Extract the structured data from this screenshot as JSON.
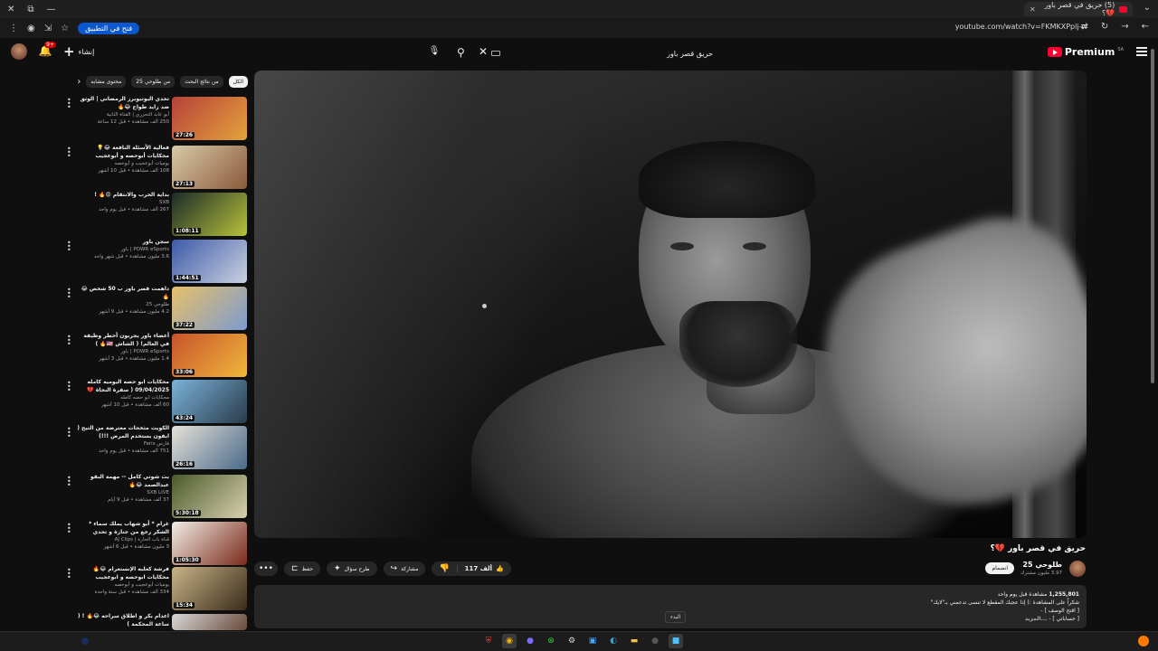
{
  "browser": {
    "tab_title": "(5) حريق في قصر باور 💔؟",
    "url": "youtube.com/watch?v=FKMKXPplj-w",
    "open_in_app": "فتح في التطبيق"
  },
  "masthead": {
    "create_label": "إنشاء",
    "notifications_badge": "9+",
    "search_value": "حريق قصر باور",
    "logo_text": "Premium",
    "logo_region": "SA"
  },
  "chips": [
    "الكل",
    "من نتائج البحث",
    "من طلوحي 25",
    "محتوى مشابه"
  ],
  "related": [
    {
      "title": "تحدي اليوتيوبرز الرمضاني | الوثق ضد زايد طواح 😂🔥",
      "channel": "أبو عابد التحرري | القناة الثانية",
      "meta": "250 ألف مشاهدة • قبل 12 ساعة",
      "duration": "27:26",
      "c1": "#b6413a",
      "c2": "#e4a23b"
    },
    {
      "title": "فعالية الأسئلة النافعة 😂💡 محكايات أبوحصه و أبوعجيب",
      "channel": "يوميات أبوعجيب و أبوحصه",
      "meta": "108 ألف مشاهدة • قبل 10 أشهر",
      "duration": "27:13",
      "c1": "#d8c9a8",
      "c2": "#8a5a3a"
    },
    {
      "title": "بداية الحرب والانتقام 😡🔥 !",
      "channel": "SXB",
      "meta": "267 ألف مشاهدة • قبل يوم واحد",
      "duration": "1:08:11",
      "c1": "#1b2a28",
      "c2": "#b7c23a"
    },
    {
      "title": "سجن باور",
      "channel": "POWR eSports | باور",
      "meta": "3.6 مليون مشاهدة • قبل شهر واحد",
      "duration": "1:44:51",
      "c1": "#3d5aa8",
      "c2": "#c9d1e0"
    },
    {
      "title": "داهمت قصر باور ب 50 شخص 😂🔥",
      "channel": "طلوحي 25",
      "meta": "4.2 مليون مشاهدة • قبل 9 أشهر",
      "duration": "37:22",
      "c1": "#e6c06a",
      "c2": "#7e9bcf"
    },
    {
      "title": "أعضاء باور يجربون أخطر وظيفة في العالم! ( الشاش 🇺🇸🔥 )",
      "channel": "POWR eSports | باور",
      "meta": "1.4 مليون مشاهدة • قبل 3 أشهر",
      "duration": "33:06",
      "c1": "#c8532c",
      "c2": "#f0b73a"
    },
    {
      "title": "محكايات ابو حصه اليوميه كامله 09/04/2025 ( سفرة النجاة 💔",
      "channel": "محكايات ابو حصه كامله",
      "meta": "60 ألف مشاهدة • قبل 10 أشهر",
      "duration": "43:24",
      "c1": "#7ab3d9",
      "c2": "#2a3a4a"
    },
    {
      "title": "الكويت مثخحات معترضة من التيح ( ايفون يستخدم المرض !!!)",
      "channel": "فارس Faris",
      "meta": "751 ألف مشاهدة • قبل يوم واحد",
      "duration": "26:16",
      "c1": "#e6e2d8",
      "c2": "#4a6a8a"
    },
    {
      "title": "بث شوتي كامل -- مهمة البقو عبدالصمد 😂🔥",
      "channel": "SXB LIVE",
      "meta": "37 ألف مشاهدة • قبل 9 أيام",
      "duration": "5:30:18",
      "c1": "#4a5a2a",
      "c2": "#d9d0b0"
    },
    {
      "title": "غرام * أبو شهاب يملك سماء * الشكر رجع من جنازة و تحدي شوكت - أقوى محكايا باب الحارة",
      "channel": "قناة باب الحارة | AJ Clips",
      "meta": "3 مليون مشاهدة • قبل 6 أشهر",
      "duration": "1:05:30",
      "c1": "#f2ede4",
      "c2": "#7a2a1a"
    },
    {
      "title": "فرشة كعلبه الإنستغرام 😂🔥 محكايات ابوحصه و ابوعجيب",
      "channel": "يوميات أبوعجيب و أبوحصه",
      "meta": "334 ألف مشاهدة • قبل سنة واحدة",
      "duration": "15:34",
      "c1": "#c9b488",
      "c2": "#3a2a1a"
    },
    {
      "title": "اعدام بكر و اطلاق سراحه 😂🔥 ! ( ساعة المحكمة )",
      "channel": "",
      "meta": "",
      "duration": "",
      "c1": "#d8d8d8",
      "c2": "#6a4a3a"
    }
  ],
  "video": {
    "title": "حريق في قصر باور 💔؟",
    "channel": "طلوحي 25",
    "subscribers": "3.97 مليون مشترك",
    "join_label": "انضمام",
    "likes": "117 ألف",
    "share_label": "مشاركة",
    "ask_label": "طرح سؤال",
    "save_label": "حفظ",
    "views": "1,255,801",
    "desc_lines": [
      "مشاهدة  قبل يوم واحد",
      "شكراً على المشاهدة :) إذا عجبك المقطع لا تنسى تدعمني بـ\"لايك\"",
      "[ اقتح الوصف ] -",
      "[ حساباتي ] -"
    ],
    "more_label": "...المزيد"
  },
  "taskbar": {
    "start_tooltip": "البدء"
  }
}
